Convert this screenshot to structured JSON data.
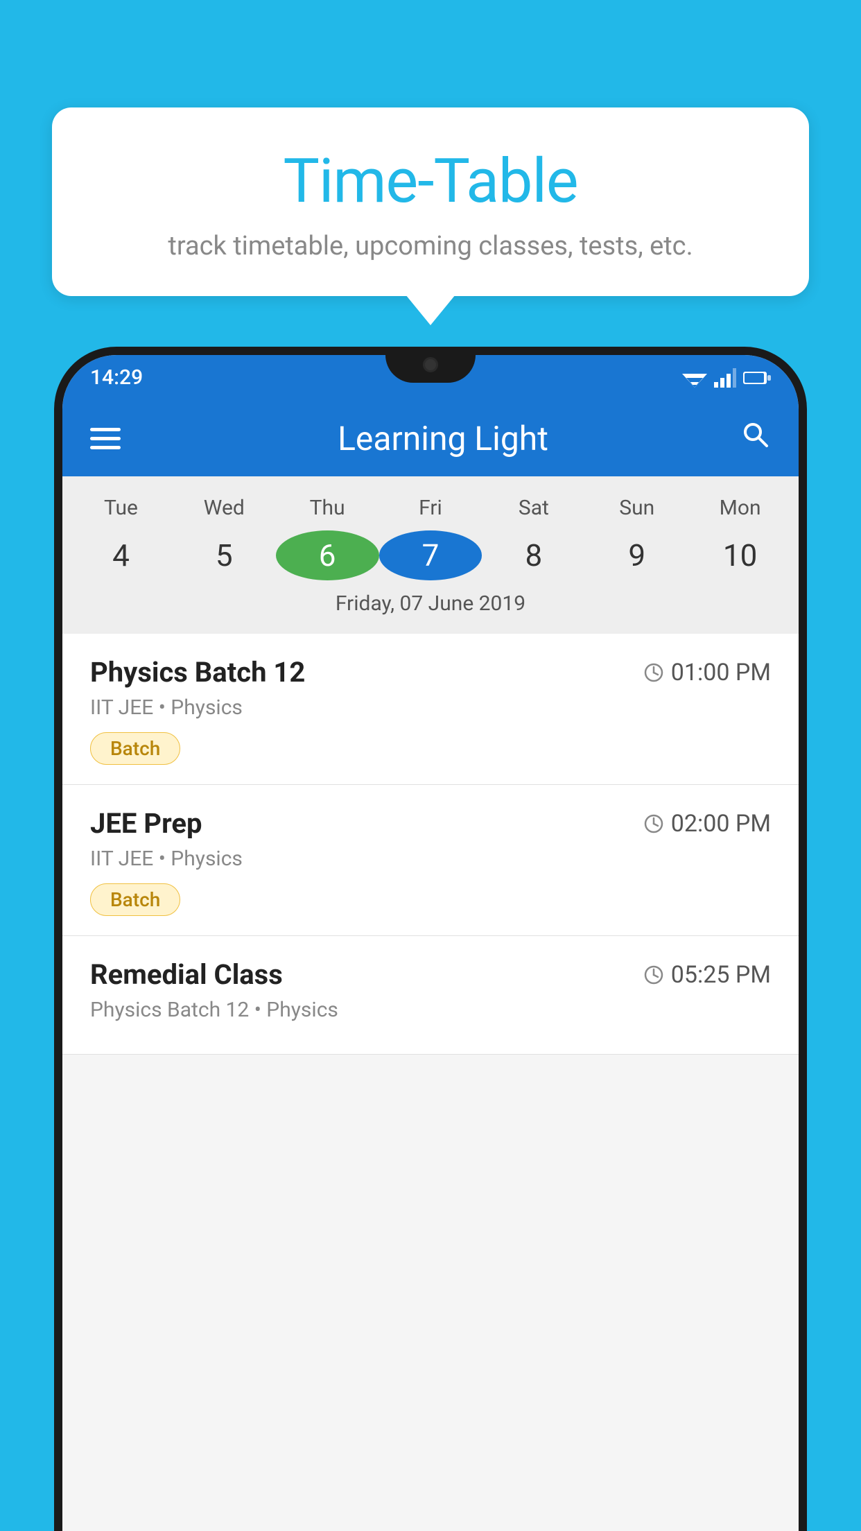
{
  "background_color": "#22b8e8",
  "speech_bubble": {
    "title": "Time-Table",
    "subtitle": "track timetable, upcoming classes, tests, etc."
  },
  "phone": {
    "status_bar": {
      "time": "14:29"
    },
    "app_bar": {
      "title": "Learning Light"
    },
    "calendar": {
      "days": [
        {
          "label": "Tue",
          "number": "4"
        },
        {
          "label": "Wed",
          "number": "5"
        },
        {
          "label": "Thu",
          "number": "6",
          "state": "today"
        },
        {
          "label": "Fri",
          "number": "7",
          "state": "selected"
        },
        {
          "label": "Sat",
          "number": "8"
        },
        {
          "label": "Sun",
          "number": "9"
        },
        {
          "label": "Mon",
          "number": "10"
        }
      ],
      "selected_date": "Friday, 07 June 2019"
    },
    "classes": [
      {
        "name": "Physics Batch 12",
        "time": "01:00 PM",
        "meta": "IIT JEE • Physics",
        "badge": "Batch"
      },
      {
        "name": "JEE Prep",
        "time": "02:00 PM",
        "meta": "IIT JEE • Physics",
        "badge": "Batch"
      },
      {
        "name": "Remedial Class",
        "time": "05:25 PM",
        "meta": "Physics Batch 12 • Physics",
        "badge": null
      }
    ]
  }
}
